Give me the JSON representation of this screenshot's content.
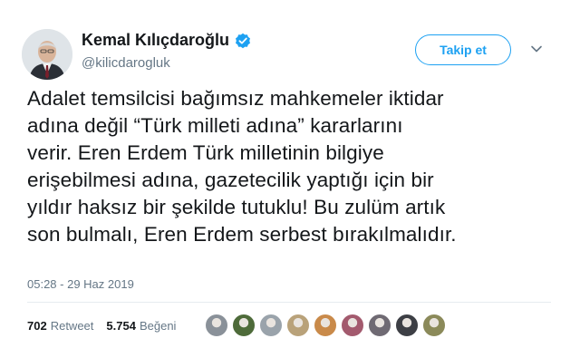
{
  "author": {
    "display_name": "Kemal Kılıçdaroğlu",
    "handle": "@kilicdarogluk",
    "verified": true
  },
  "actions": {
    "follow_label": "Takip et",
    "menu_icon": "chevron-down-icon"
  },
  "tweet": {
    "lines": [
      "Adalet temsilcisi bağımsız mahkemeler iktidar",
      "adına değil “Türk milleti adına” kararlarını",
      "verir. Eren Erdem Türk milletinin bilgiye",
      "erişebilmesi adına, gazetecilik yaptığı için bir",
      "yıldır haksız bir şekilde tutuklu! Bu zulüm artık",
      "son bulmalı, Eren Erdem serbest bırakılmalıdır."
    ],
    "timestamp": "05:28 - 29 Haz 2019"
  },
  "stats": {
    "retweets": "702",
    "retweets_label": "Retweet",
    "likes": "5.754",
    "likes_label": "Beğeni"
  },
  "likers": [
    {
      "color": "#8a9199"
    },
    {
      "color": "#4e6b3a"
    },
    {
      "color": "#9aa3ab"
    },
    {
      "color": "#b9a27a"
    },
    {
      "color": "#c98a4a"
    },
    {
      "color": "#a35a6e"
    },
    {
      "color": "#6f6a73"
    },
    {
      "color": "#3d3f45"
    },
    {
      "color": "#8b8a5a"
    }
  ],
  "colors": {
    "accent": "#1da1f2",
    "text": "#14171a",
    "secondary": "#657786"
  }
}
